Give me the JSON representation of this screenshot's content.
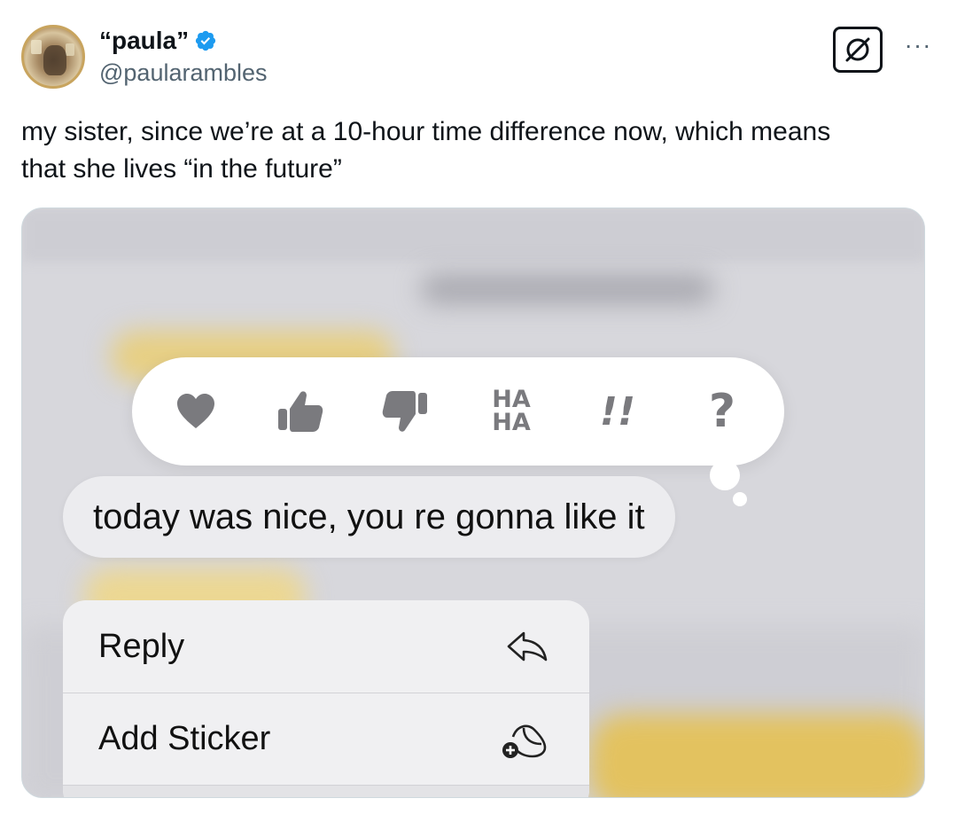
{
  "tweet": {
    "display_name": "“paula”",
    "handle": "@paularambles",
    "text": "my sister, since we’re at a 10-hour time difference now, which means\nthat she lives “in the future”",
    "verified_color": "#1d9bf0"
  },
  "header_icons": {
    "grok": "grok-icon",
    "more": "more-icon",
    "more_glyph": "···"
  },
  "media": {
    "tapback_reactions": [
      {
        "icon": "heart-icon"
      },
      {
        "icon": "thumbs-up-icon"
      },
      {
        "icon": "thumbs-down-icon"
      },
      {
        "icon": "haha-icon",
        "text_top": "HA",
        "text_bottom": "HA"
      },
      {
        "icon": "exclamation-icon",
        "text": "!!"
      },
      {
        "icon": "question-icon",
        "text": "?"
      }
    ],
    "message_text": "today was nice, you re gonna like it",
    "menu": {
      "reply_label": "Reply",
      "add_sticker_label": "Add Sticker"
    },
    "reaction_color": "#7a7a7e"
  }
}
